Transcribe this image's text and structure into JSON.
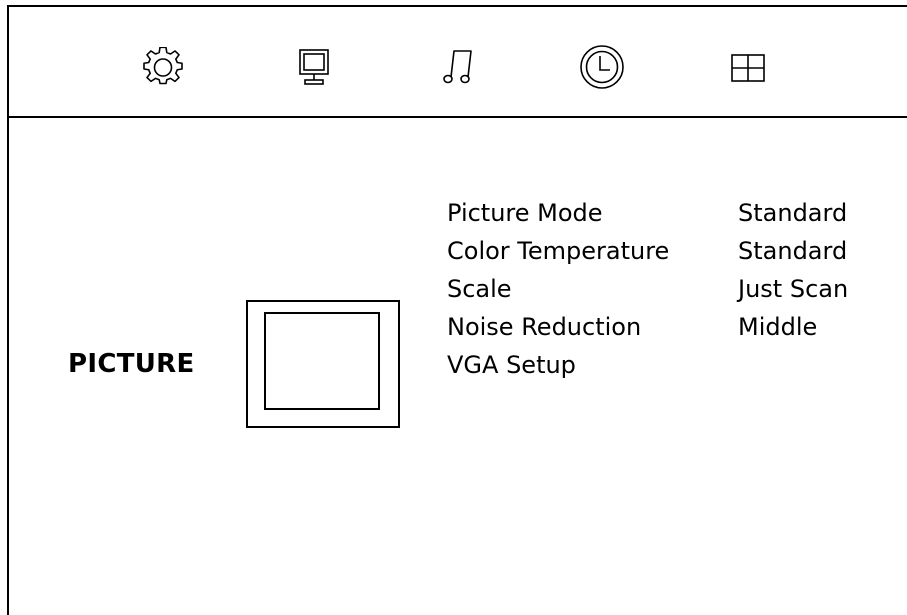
{
  "tabs": [
    {
      "name": "setup",
      "icon": "gear-icon"
    },
    {
      "name": "picture",
      "icon": "monitor-icon"
    },
    {
      "name": "sound",
      "icon": "music-note-icon"
    },
    {
      "name": "time",
      "icon": "clock-icon"
    },
    {
      "name": "option",
      "icon": "grid-icon"
    }
  ],
  "section": {
    "title": "PICTURE",
    "preview_icon": "picture-frame-icon"
  },
  "menu": {
    "items": [
      {
        "label": "Picture Mode",
        "value": "Standard"
      },
      {
        "label": "Color Temperature",
        "value": "Standard"
      },
      {
        "label": "Scale",
        "value": "Just Scan"
      },
      {
        "label": "Noise Reduction",
        "value": "Middle"
      },
      {
        "label": "VGA Setup",
        "value": ""
      }
    ]
  },
  "colors": {
    "background": "#ffffff",
    "foreground": "#000000"
  }
}
